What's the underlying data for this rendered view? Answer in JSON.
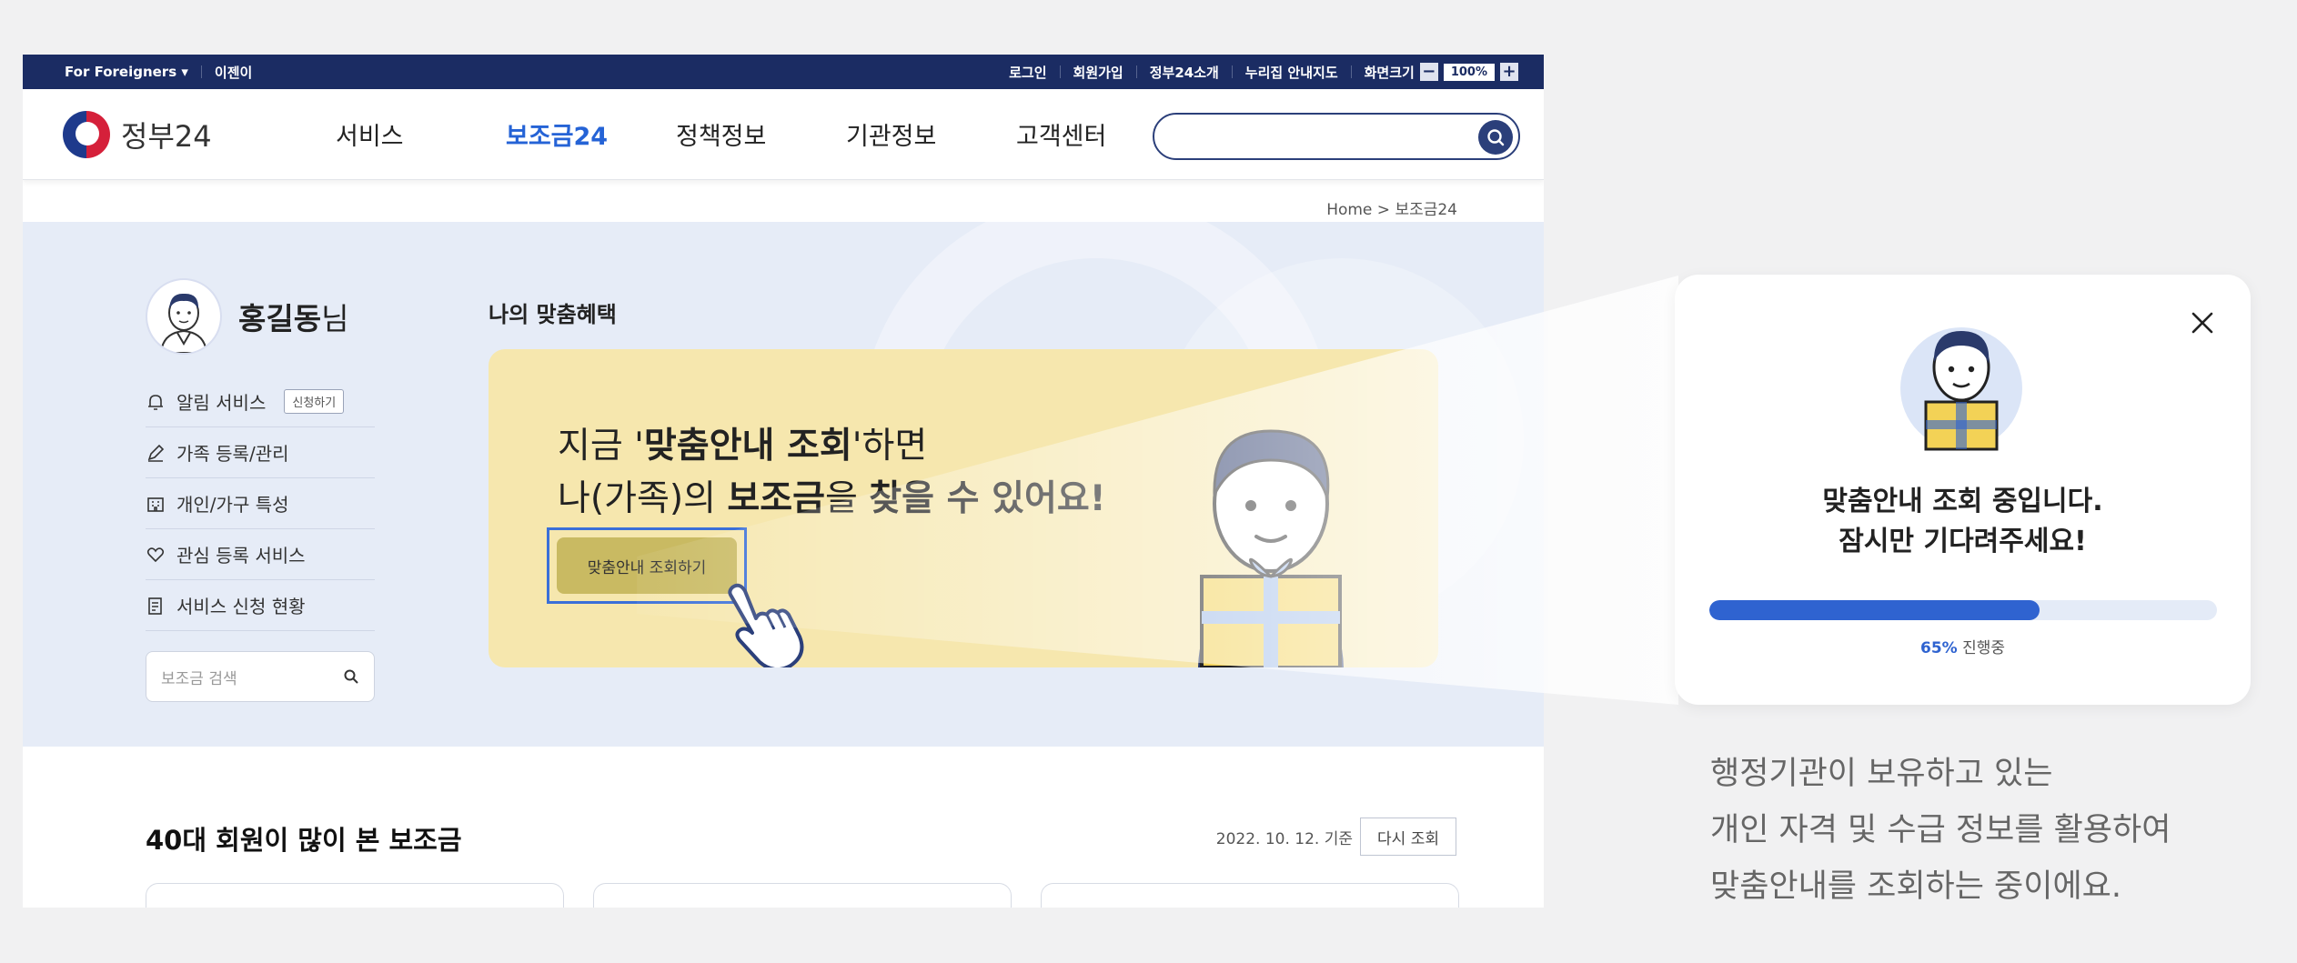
{
  "utilbar": {
    "foreigners": "For Foreigners ▾",
    "easy": "이젠이",
    "links": [
      "로그인",
      "회원가입",
      "정부24소개",
      "누리집 안내지도",
      "화면크기"
    ],
    "zoom_value": "100%"
  },
  "header": {
    "logo_text": "정부24",
    "nav": [
      "서비스",
      "보조금24",
      "정책정보",
      "기관정보",
      "고객센터"
    ],
    "active_index": 1,
    "search_placeholder": ""
  },
  "breadcrumb": "Home > 보조금24",
  "profile": {
    "name": "홍길동",
    "suffix": "님"
  },
  "sidebar": {
    "items": [
      {
        "label": "알림 서비스",
        "tag": "신청하기",
        "icon": "bell-icon"
      },
      {
        "label": "가족 등록/관리",
        "icon": "edit-icon"
      },
      {
        "label": "개인/가구 특성",
        "icon": "building-icon"
      },
      {
        "label": "관심 등록 서비스",
        "icon": "heart-icon"
      },
      {
        "label": "서비스 신청 현황",
        "icon": "document-icon"
      }
    ],
    "search_placeholder": "보조금 검색"
  },
  "benefit": {
    "title": "나의 맞춤혜택",
    "line1_a": "지금 '",
    "line1_b": "맞춤안내 조회",
    "line1_c": "'하면",
    "line2_a": "나(가족)의 ",
    "line2_b": "보조금",
    "line2_c": "을 ",
    "line2_d": "찾을 수 있어요!",
    "cta": "맞춤안내 조회하기"
  },
  "section": {
    "title": "40대 회원이 많이 본 보조금",
    "date": "2022. 10. 12. 기준",
    "refresh": "다시 조회"
  },
  "popup": {
    "line1": "맞춤안내 조회 중입니다.",
    "line2": "잠시만 기다려주세요!",
    "progress": 65,
    "progress_label": "65%",
    "progress_suffix": " 진행중"
  },
  "description": [
    "행정기관이 보유하고 있는",
    "개인 자격 및 수급 정보를 활용하여",
    "맞춤안내를 조회하는 중이에요."
  ],
  "colors": {
    "navy": "#1b2c63",
    "accent": "#2563d6",
    "banner": "#f6e7ae",
    "hero": "#e6ecf7"
  }
}
